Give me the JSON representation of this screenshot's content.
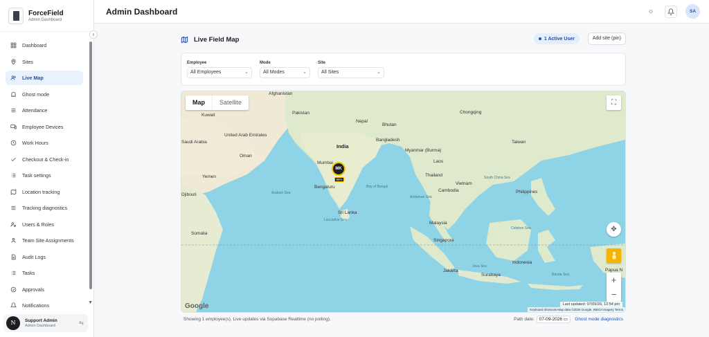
{
  "brand": {
    "name": "ForceField",
    "subtitle": "Admin Dashboard"
  },
  "sidebar": {
    "items": [
      {
        "label": "Dashboard",
        "icon": "grid-icon"
      },
      {
        "label": "Sites",
        "icon": "pin-icon"
      },
      {
        "label": "Live Map",
        "icon": "users-icon",
        "active": true
      },
      {
        "label": "Ghost mode",
        "icon": "ghost-icon"
      },
      {
        "label": "Attendance",
        "icon": "list-icon"
      },
      {
        "label": "Employee Devices",
        "icon": "devices-icon"
      },
      {
        "label": "Work Hours",
        "icon": "clock-icon"
      },
      {
        "label": "Checkout & Check-in",
        "icon": "check-icon"
      },
      {
        "label": "Task settings",
        "icon": "task-list-icon"
      },
      {
        "label": "Location tracking",
        "icon": "map-icon"
      },
      {
        "label": "Tracking diagnostics",
        "icon": "list-icon"
      },
      {
        "label": "Users & Roles",
        "icon": "user-gear-icon"
      },
      {
        "label": "Team Site Assignments",
        "icon": "team-icon"
      },
      {
        "label": "Audit Logs",
        "icon": "document-icon"
      },
      {
        "label": "Tasks",
        "icon": "task-list-icon"
      },
      {
        "label": "Approvals",
        "icon": "approval-icon"
      },
      {
        "label": "Notifications",
        "icon": "bell-icon"
      }
    ],
    "user": {
      "initial": "N",
      "name": "Support Admin",
      "role": "Admin Dashboard"
    }
  },
  "header": {
    "title": "Admin Dashboard",
    "avatar": "SA"
  },
  "live_map": {
    "title": "Live Field Map",
    "active_users": "1 Active User",
    "add_site": "Add site (pin)",
    "filters": [
      {
        "label": "Employee",
        "value": "All Employees"
      },
      {
        "label": "Mode",
        "value": "All Modes"
      },
      {
        "label": "Site",
        "value": "All Sites"
      }
    ],
    "map_type": {
      "map": "Map",
      "satellite": "Satellite"
    },
    "marker": {
      "initials": "MK",
      "badge": "95%"
    },
    "last_updated": "Last updated: 07/09/26, 12:54 pm",
    "attribution": "Keyboard shortcuts   Map data ©2026 Google, INEGI Imagery   Terms",
    "google": "Google",
    "places": [
      {
        "name": "Afghanistan",
        "kind": "country"
      },
      {
        "name": "Pakistan",
        "kind": "country"
      },
      {
        "name": "Nepal",
        "kind": "country"
      },
      {
        "name": "Bhutan",
        "kind": "country"
      },
      {
        "name": "India",
        "kind": "country-big"
      },
      {
        "name": "Bangladesh",
        "kind": "country"
      },
      {
        "name": "Myanmar (Burma)",
        "kind": "country"
      },
      {
        "name": "Laos",
        "kind": "country"
      },
      {
        "name": "Thailand",
        "kind": "country"
      },
      {
        "name": "Vietnam",
        "kind": "country"
      },
      {
        "name": "Cambodia",
        "kind": "country"
      },
      {
        "name": "Philippines",
        "kind": "country"
      },
      {
        "name": "Taiwan",
        "kind": "country"
      },
      {
        "name": "Malaysia",
        "kind": "country"
      },
      {
        "name": "Singapore",
        "kind": "country"
      },
      {
        "name": "Indonesia",
        "kind": "country"
      },
      {
        "name": "Sri Lanka",
        "kind": "country"
      },
      {
        "name": "Kuwait",
        "kind": "country"
      },
      {
        "name": "Saudi Arabia",
        "kind": "country"
      },
      {
        "name": "United Arab Emirates",
        "kind": "country"
      },
      {
        "name": "Oman",
        "kind": "country"
      },
      {
        "name": "Yemen",
        "kind": "country"
      },
      {
        "name": "Djibouti",
        "kind": "country"
      },
      {
        "name": "Somalia",
        "kind": "country"
      },
      {
        "name": "Papua N",
        "kind": "country"
      },
      {
        "name": "Chongqing",
        "kind": "city"
      },
      {
        "name": "Mumbai",
        "kind": "city"
      },
      {
        "name": "Bengaluru",
        "kind": "city"
      },
      {
        "name": "Jakarta",
        "kind": "city"
      },
      {
        "name": "Surabaya",
        "kind": "city"
      },
      {
        "name": "Bay of Bengal",
        "kind": "sea"
      },
      {
        "name": "Arabian Sea",
        "kind": "sea"
      },
      {
        "name": "South China Sea",
        "kind": "sea"
      },
      {
        "name": "Laccadive Sea",
        "kind": "sea"
      },
      {
        "name": "Andaman Sea",
        "kind": "sea"
      },
      {
        "name": "Java Sea",
        "kind": "sea"
      },
      {
        "name": "Celebes Sea",
        "kind": "sea"
      },
      {
        "name": "Banda Sea",
        "kind": "sea"
      }
    ]
  },
  "footer": {
    "showing": "Showing 1 employee(s). Live updates via Supabase Realtime (no polling).",
    "path_date_label": "Path date:",
    "path_date_value": "07-09-2026",
    "ghost_link": "Ghost mode diagnostics"
  },
  "colors": {
    "accent": "#1e4fb8",
    "accent_bg": "#e9f1fd",
    "marker_ring": "#f5c400",
    "water": "#8fd3e6",
    "land": "#e8eed7"
  }
}
